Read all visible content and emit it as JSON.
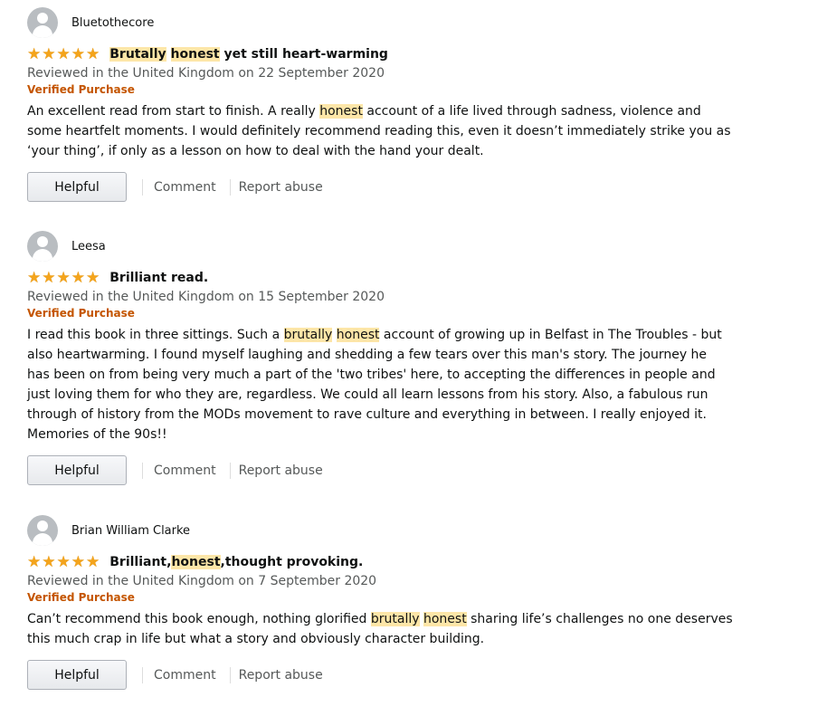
{
  "reviews": [
    {
      "profile_name": "Bluetothecore",
      "title": "Brutally honest yet still heart-warming",
      "title_parts": [
        "",
        "Brutally",
        " ",
        "honest",
        " yet still heart-warming"
      ],
      "date": "Reviewed in the United Kingdom on 22 September 2020",
      "verified": "Verified Purchase",
      "body_parts": [
        "An excellent read from start to finish. A really ",
        "honest",
        " account of a life lived through sadness, violence and some heartfelt moments. I would definitely recommend reading this, even it doesn’t immediately strike you as ‘your thing’, if only as a lesson on how to deal with the hand your dealt."
      ],
      "helpful": "Helpful",
      "comment": "Comment",
      "report": "Report abuse"
    },
    {
      "profile_name": "Leesa",
      "title": "Brilliant read.",
      "date": "Reviewed in the United Kingdom on 15 September 2020",
      "verified": "Verified Purchase",
      "body_parts": [
        "I read this book in three sittings. Such a ",
        "brutally",
        " ",
        "honest",
        " account of growing up in Belfast in The Troubles - but also heartwarming. I found myself laughing and shedding a few tears over this man's story. The journey he has been on from being very much a part of the 'two tribes' here, to accepting the differences in people and just loving them for who they are, regardless. We could all learn lessons from his story. Also, a fabulous run through of history from the MODs movement to rave culture and everything in between. I really enjoyed it. Memories of the 90s!!"
      ],
      "helpful": "Helpful",
      "comment": "Comment",
      "report": "Report abuse"
    },
    {
      "profile_name": "Brian William Clarke",
      "title_parts": [
        "Brilliant,",
        "honest",
        ",thought provoking."
      ],
      "date": "Reviewed in the United Kingdom on 7 September 2020",
      "verified": "Verified Purchase",
      "body_parts": [
        "Can’t recommend this book enough, nothing glorified ",
        "brutally",
        " ",
        "honest",
        " sharing life’s challenges no one deserves this much crap in life but what a story and obviously character building."
      ],
      "helpful": "Helpful",
      "comment": "Comment",
      "report": "Report abuse"
    }
  ],
  "rating_stars": 5,
  "colors": {
    "star": "#f4a41c",
    "highlight": "#fde6a8",
    "verified": "#c45500"
  }
}
